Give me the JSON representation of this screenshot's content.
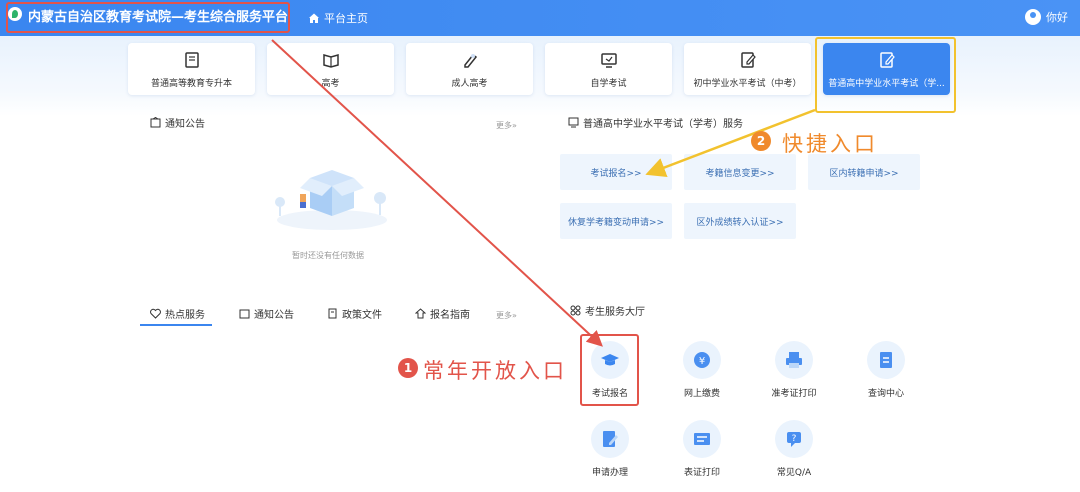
{
  "header": {
    "title": "内蒙古自治区教育考试院—考生综合服务平台",
    "home_label": "平台主页",
    "user_name": "你好"
  },
  "exam_tabs": [
    {
      "label": "普通高等教育专升本",
      "icon": "book-icon"
    },
    {
      "label": "高考",
      "icon": "open-book-icon"
    },
    {
      "label": "成人高考",
      "icon": "pen-icon"
    },
    {
      "label": "自学考试",
      "icon": "monitor-icon"
    },
    {
      "label": "初中学业水平考试（中考）",
      "icon": "edit-doc-icon"
    },
    {
      "label": "普通高中学业水平考试（学...",
      "icon": "edit-doc-icon",
      "active": true
    }
  ],
  "notice": {
    "title": "通知公告",
    "more": "更多»",
    "empty_text": "暂时还没有任何数据"
  },
  "service": {
    "title": "普通高中学业水平考试（学考）服务",
    "buttons": [
      "考试报名>>",
      "考籍信息变更>>",
      "区内转籍申请>>",
      "休复学考籍变动申请>>",
      "区外成绩转入认证>>"
    ]
  },
  "bottom_tabs": {
    "items": [
      "热点服务",
      "通知公告",
      "政策文件",
      "报名指南"
    ],
    "more": "更多»"
  },
  "hall": {
    "title": "考生服务大厅",
    "items": [
      "考试报名",
      "网上缴费",
      "准考证打印",
      "查询中心",
      "申请办理",
      "表证打印",
      "常见Q/A"
    ]
  },
  "annotations": {
    "badge1": "1",
    "label1": "常年开放入口",
    "badge2": "2",
    "label2": "快捷入口"
  },
  "colors": {
    "primary": "#3b86ef",
    "red_annotation": "#e2544a",
    "yellow_annotation": "#f2c22e",
    "orange_badge": "#f08a2c"
  }
}
